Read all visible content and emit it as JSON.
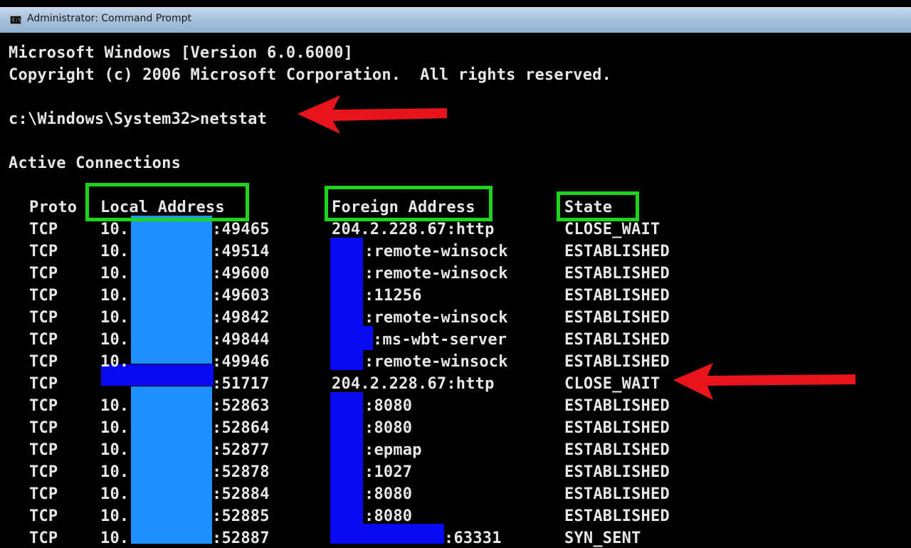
{
  "window": {
    "title": "Administrator: Command Prompt",
    "icon": "cmd-icon"
  },
  "console": {
    "banner": [
      "Microsoft Windows [Version 6.0.6000]",
      "Copyright (c) 2006 Microsoft Corporation.  All rights reserved."
    ],
    "prompt": "c:\\Windows\\System32>netstat",
    "section_title": "Active Connections",
    "headers": {
      "proto": "Proto",
      "local_address": "Local Address",
      "foreign_address": "Foreign Address",
      "state": "State"
    },
    "rows": [
      {
        "proto": "TCP",
        "local_prefix": "10.",
        "local_port": ":49465",
        "foreign": "204.2.228.67:http",
        "state": "CLOSE_WAIT"
      },
      {
        "proto": "TCP",
        "local_prefix": "10.",
        "local_port": ":49514",
        "foreign": ":remote-winsock",
        "state": "ESTABLISHED"
      },
      {
        "proto": "TCP",
        "local_prefix": "10.",
        "local_port": ":49600",
        "foreign": ":remote-winsock",
        "state": "ESTABLISHED"
      },
      {
        "proto": "TCP",
        "local_prefix": "10.",
        "local_port": ":49603",
        "foreign": ":11256",
        "state": "ESTABLISHED"
      },
      {
        "proto": "TCP",
        "local_prefix": "10.",
        "local_port": ":49842",
        "foreign": ":remote-winsock",
        "state": "ESTABLISHED"
      },
      {
        "proto": "TCP",
        "local_prefix": "10.",
        "local_port": ":49844",
        "foreign": ":ms-wbt-server",
        "state": "ESTABLISHED"
      },
      {
        "proto": "TCP",
        "local_prefix": "10.",
        "local_port": ":49946",
        "foreign": ":remote-winsock",
        "state": "ESTABLISHED"
      },
      {
        "proto": "TCP",
        "local_prefix": "",
        "local_port": ":51717",
        "foreign": "204.2.228.67:http",
        "state": "CLOSE_WAIT"
      },
      {
        "proto": "TCP",
        "local_prefix": "10.",
        "local_port": ":52863",
        "foreign": ":8080",
        "state": "ESTABLISHED"
      },
      {
        "proto": "TCP",
        "local_prefix": "10.",
        "local_port": ":52864",
        "foreign": ":8080",
        "state": "ESTABLISHED"
      },
      {
        "proto": "TCP",
        "local_prefix": "10.",
        "local_port": ":52877",
        "foreign": ":epmap",
        "state": "ESTABLISHED"
      },
      {
        "proto": "TCP",
        "local_prefix": "10.",
        "local_port": ":52878",
        "foreign": ":1027",
        "state": "ESTABLISHED"
      },
      {
        "proto": "TCP",
        "local_prefix": "10.",
        "local_port": ":52884",
        "foreign": ":8080",
        "state": "ESTABLISHED"
      },
      {
        "proto": "TCP",
        "local_prefix": "10.",
        "local_port": ":52885",
        "foreign": ":8080",
        "state": "ESTABLISHED"
      },
      {
        "proto": "TCP",
        "local_prefix": "10.",
        "local_port": ":52887",
        "foreign": ":63331",
        "state": "SYN_SENT"
      }
    ]
  },
  "colors": {
    "background": "#000000",
    "text": "#e6e6e6",
    "highlight": "#1bd41b",
    "arrow": "#e8141b",
    "redact_light": "#1e90ff",
    "redact_dark": "#0a0af0"
  }
}
